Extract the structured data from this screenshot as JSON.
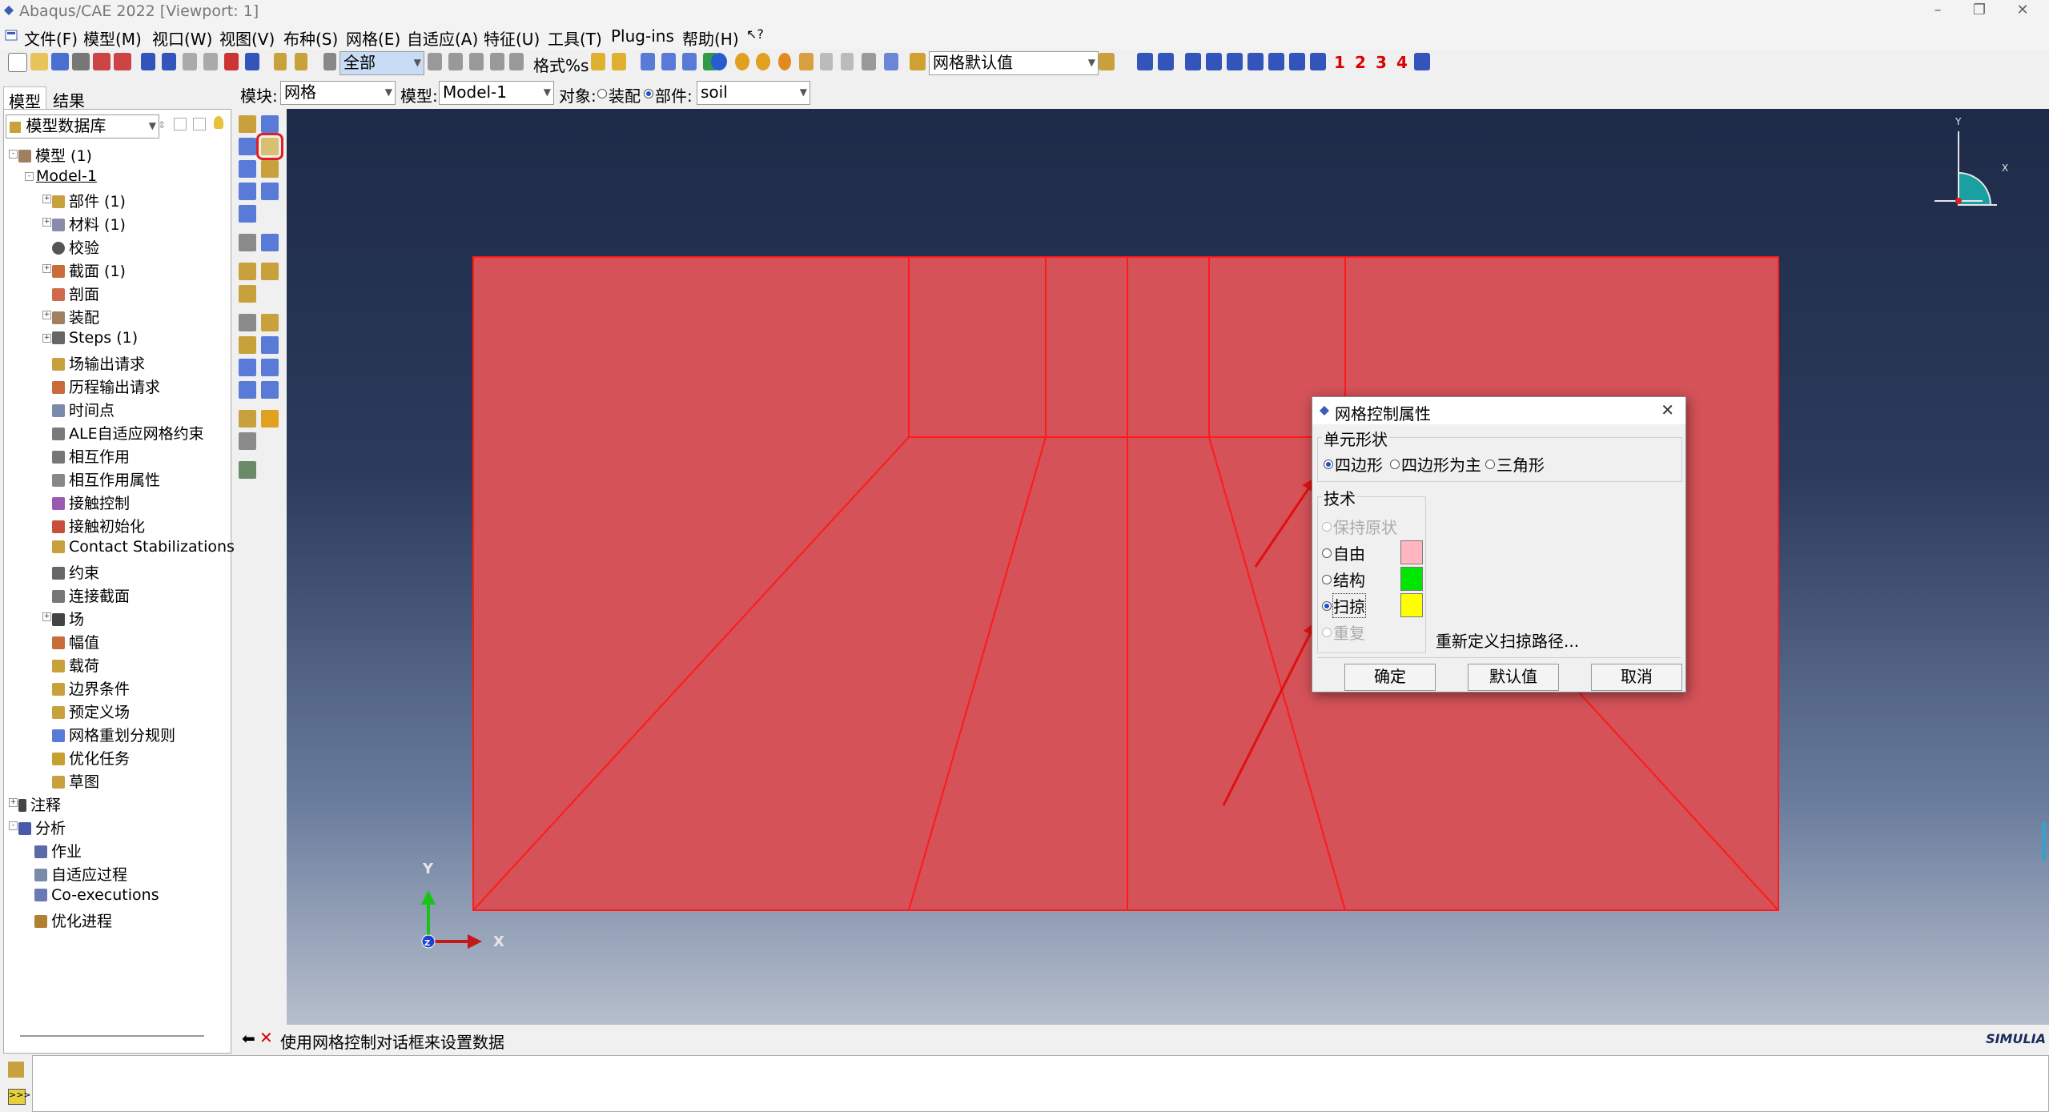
{
  "window": {
    "title": "Abaqus/CAE 2022 [Viewport: 1]"
  },
  "menu": [
    {
      "label": "文件(F)"
    },
    {
      "label": "模型(M)"
    },
    {
      "label": "视口(W)"
    },
    {
      "label": "视图(V)"
    },
    {
      "label": "布种(S)"
    },
    {
      "label": "网格(E)"
    },
    {
      "label": "自适应(A)"
    },
    {
      "label": "特征(U)"
    },
    {
      "label": "工具(T)"
    },
    {
      "label": "Plug-ins"
    },
    {
      "label": "帮助(H)"
    }
  ],
  "toolbar": {
    "select_value": "全部",
    "format_label": "格式%s",
    "mesh_defaults_value": "网格默认值",
    "view_numbers": [
      "1",
      "2",
      "3",
      "4"
    ]
  },
  "context": {
    "module_label": "模块:",
    "module_value": "网格",
    "model_label": "模型:",
    "model_value": "Model-1",
    "object_label": "对象:",
    "assembly_label": "装配",
    "part_label": "部件:",
    "part_value": "soil"
  },
  "left_tabs": [
    "模型",
    "结果"
  ],
  "tree_filter": "模型数据库",
  "tree": [
    {
      "label": "模型 (1)"
    },
    {
      "label": "Model-1"
    },
    {
      "label": "部件 (1)"
    },
    {
      "label": "材料 (1)"
    },
    {
      "label": "校验"
    },
    {
      "label": "截面 (1)"
    },
    {
      "label": "剖面"
    },
    {
      "label": "装配"
    },
    {
      "label": "Steps (1)"
    },
    {
      "label": "场输出请求"
    },
    {
      "label": "历程输出请求"
    },
    {
      "label": "时间点"
    },
    {
      "label": "ALE自适应网格约束"
    },
    {
      "label": "相互作用"
    },
    {
      "label": "相互作用属性"
    },
    {
      "label": "接触控制"
    },
    {
      "label": "接触初始化"
    },
    {
      "label": "Contact Stabilizations"
    },
    {
      "label": "约束"
    },
    {
      "label": "连接截面"
    },
    {
      "label": "场"
    },
    {
      "label": "幅值"
    },
    {
      "label": "载荷"
    },
    {
      "label": "边界条件"
    },
    {
      "label": "预定义场"
    },
    {
      "label": "网格重划分规则"
    },
    {
      "label": "优化任务"
    },
    {
      "label": "草图"
    },
    {
      "label": "注释"
    },
    {
      "label": "分析"
    },
    {
      "label": "作业"
    },
    {
      "label": "自适应过程"
    },
    {
      "label": "Co-executions"
    },
    {
      "label": "优化进程"
    }
  ],
  "viewport": {
    "triad_x": "X",
    "triad_y": "Y",
    "triad_z": "Z",
    "mini_triad_x": "X",
    "mini_triad_y": "Y",
    "brand": "SIMULIA",
    "mesh_color": "#d45258",
    "edge_color": "#ff1a1a"
  },
  "prompt": {
    "text": "使用网格控制对话框来设置数据"
  },
  "dialog": {
    "title": "网格控制属性",
    "shape_group": "单元形状",
    "shape_options": [
      {
        "label": "四边形",
        "selected": true
      },
      {
        "label": "四边形为主",
        "selected": false
      },
      {
        "label": "三角形",
        "selected": false
      }
    ],
    "tech_group": "技术",
    "tech_options": [
      {
        "label": "保持原状",
        "disabled": true
      },
      {
        "label": "自由",
        "color": "#ffb6c1"
      },
      {
        "label": "结构",
        "color": "#00e600"
      },
      {
        "label": "扫掠",
        "color": "#ffff00",
        "selected": true
      },
      {
        "label": "重复",
        "disabled": true
      }
    ],
    "redefine_button": "重新定义扫掠路径...",
    "ok": "确定",
    "defaults": "默认值",
    "cancel": "取消"
  }
}
